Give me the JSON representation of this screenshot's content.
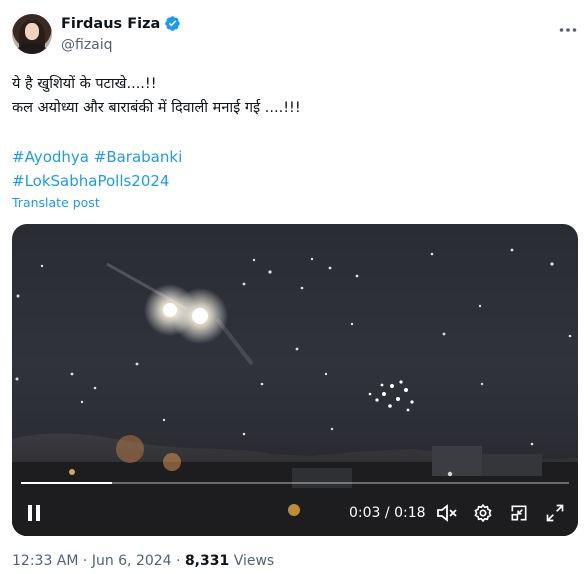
{
  "author": {
    "display_name": "Firdaus Fiza",
    "handle": "@fizaiq",
    "verified": true,
    "verified_color": "#1d9bf0"
  },
  "tweet": {
    "lines": [
      "ये है खुशियों के पटाखे....!!",
      "कल अयोध्या और बाराबंकी में दिवाली मनाई गई  ....!!!"
    ],
    "hashtags": [
      "#Ayodhya",
      "#Barabanki",
      "#LokSabhaPolls2024"
    ],
    "translate_label": "Translate post"
  },
  "video": {
    "current_time": "0:03",
    "separator": "/",
    "duration": "0:18",
    "progress": 0.1667,
    "controls": [
      "pause-icon",
      "mute-icon",
      "settings-icon",
      "pip-icon",
      "fullscreen-icon"
    ]
  },
  "meta": {
    "time": "12:33 AM",
    "dot1": "·",
    "date": "Jun 6, 2024",
    "dot2": "·",
    "views_count": "8,331",
    "views_label": "Views"
  },
  "colors": {
    "link": "#1d9bf0",
    "secondary_text": "#536471",
    "primary_text": "#0f1419"
  }
}
